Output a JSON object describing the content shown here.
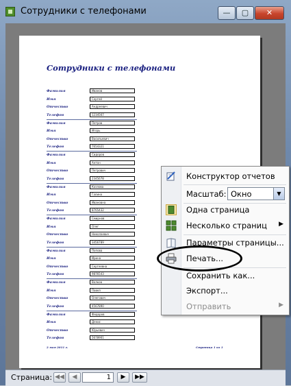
{
  "window": {
    "title": "Сотрудники с телефонами",
    "min_glyph": "—",
    "max_glyph": "▢",
    "close_glyph": "✕"
  },
  "report": {
    "title": "Сотрудники с телефонами",
    "field_labels": [
      "Фамилия",
      "Имя",
      "Отчество",
      "Телефон"
    ],
    "records": [
      [
        "Иванов",
        "Сергей",
        "Андреевич",
        "1234567"
      ],
      [
        "Петров",
        "Игорь",
        "Васильевич",
        "7654321"
      ],
      [
        "Сидоров",
        "Антон",
        "Петрович",
        "2345678"
      ],
      [
        "Козлова",
        "Галина",
        "Ивановна",
        "8765432"
      ],
      [
        "Смирнов",
        "Олег",
        "Николаевич",
        "3456789"
      ],
      [
        "Попова",
        "Ирина",
        "Сергеевна",
        "9876543"
      ],
      [
        "Волков",
        "Павел",
        "Олегович",
        "4567890"
      ],
      [
        "Федоров",
        "Денис",
        "Юрьевич",
        "5678901"
      ]
    ],
    "footer_left": "2 мая 2011 г.",
    "footer_right": "Страница 1 из 1"
  },
  "statusbar": {
    "label": "Страница:",
    "current_page": "1",
    "first_glyph": "◀◀",
    "prev_glyph": "◀",
    "next_glyph": "▶",
    "last_glyph": "▶▶"
  },
  "context_menu": {
    "items": [
      {
        "label": "Конструктор отчетов",
        "icon": "report-designer-icon",
        "submenu": false,
        "disabled": false
      },
      {
        "label": "Масштаб:",
        "icon": "",
        "submenu": false,
        "disabled": false
      },
      {
        "label": "Одна страница",
        "icon": "one-page-icon",
        "submenu": false,
        "disabled": false
      },
      {
        "label": "Несколько страниц",
        "icon": "multiple-pages-icon",
        "submenu": true,
        "disabled": false
      },
      {
        "label": "Параметры страницы...",
        "icon": "page-setup-icon",
        "submenu": false,
        "disabled": false
      },
      {
        "label": "Печать...",
        "icon": "print-icon",
        "submenu": false,
        "disabled": false
      },
      {
        "label": "Сохранить как...",
        "icon": "",
        "submenu": false,
        "disabled": false
      },
      {
        "label": "Экспорт...",
        "icon": "",
        "submenu": false,
        "disabled": false
      },
      {
        "label": "Отправить",
        "icon": "",
        "submenu": true,
        "disabled": true
      }
    ],
    "zoom_value": "Окно",
    "submenu_arrow": "▶",
    "dropdown_glyph": "▼"
  },
  "colors": {
    "report_text": "#1a2080",
    "window_chrome": "#6e88ab",
    "close_button": "#c8452c"
  }
}
